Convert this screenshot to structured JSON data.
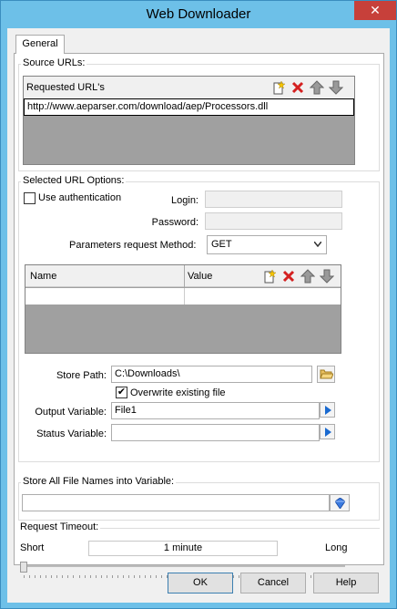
{
  "window": {
    "title": "Web Downloader",
    "close_glyph": "✕"
  },
  "tabs": [
    {
      "label": "General"
    }
  ],
  "source_urls": {
    "group_label": "Source URLs:",
    "column_header": "Requested URL's",
    "rows": [
      "http://www.aeparser.com/download/aep/Processors.dll"
    ]
  },
  "url_options": {
    "group_label": "Selected URL Options:",
    "use_auth_label": "Use authentication",
    "use_auth_checked": false,
    "login_label": "Login:",
    "login_value": "",
    "password_label": "Password:",
    "password_value": "",
    "method_label": "Parameters request Method:",
    "method_value": "GET",
    "params_columns": [
      "Name",
      "Value"
    ],
    "store_path_label": "Store Path:",
    "store_path_value": "C:\\Downloads\\",
    "overwrite_label": "Overwrite existing file",
    "overwrite_checked": true,
    "output_var_label": "Output Variable:",
    "output_var_value": "File1",
    "status_var_label": "Status Variable:",
    "status_var_value": ""
  },
  "store_all": {
    "group_label": "Store All File Names into Variable:",
    "value": ""
  },
  "timeout": {
    "group_label": "Request Timeout:",
    "short_label": "Short",
    "long_label": "Long",
    "value_label": "1 minute",
    "slider_fraction": 0.0
  },
  "buttons": {
    "ok": "OK",
    "cancel": "Cancel",
    "help": "Help"
  },
  "colors": {
    "title_bar": "#6dc0e8",
    "close": "#c7403a",
    "grid_empty": "#a0a0a0",
    "delete_red": "#d42020"
  }
}
